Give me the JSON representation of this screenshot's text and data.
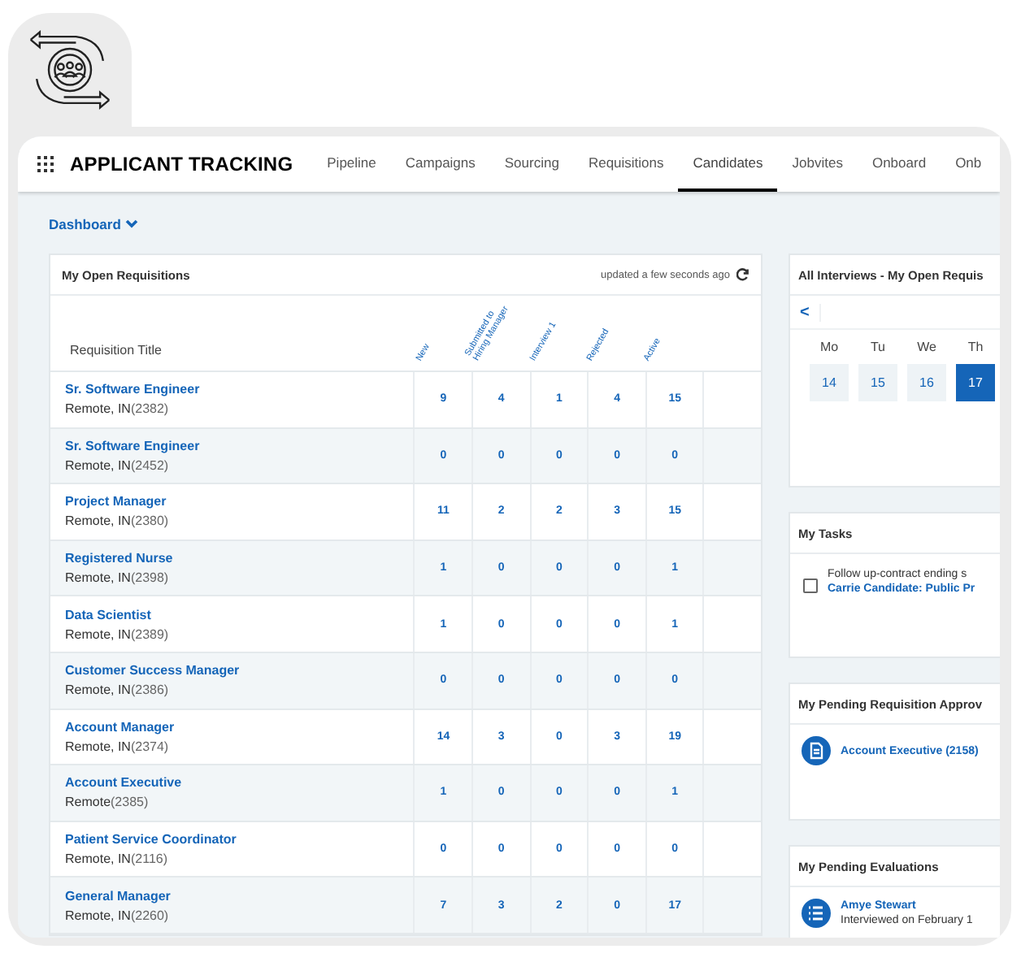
{
  "app": {
    "title": "APPLICANT TRACKING"
  },
  "tabs": [
    {
      "label": "Pipeline",
      "selected": false
    },
    {
      "label": "Campaigns",
      "selected": false
    },
    {
      "label": "Sourcing",
      "selected": false
    },
    {
      "label": "Requisitions",
      "selected": false
    },
    {
      "label": "Candidates",
      "selected": true
    },
    {
      "label": "Jobvites",
      "selected": false
    },
    {
      "label": "Onboard",
      "selected": false
    },
    {
      "label": "Onb",
      "selected": false
    }
  ],
  "breadcrumb": {
    "label": "Dashboard"
  },
  "requisitions": {
    "title": "My Open Requisitions",
    "updated": "updated a few seconds ago",
    "columns": [
      "Requisition Title",
      "New",
      "Submitted to Hiring Manager",
      "Interview 1",
      "Rejected",
      "Active"
    ],
    "rows": [
      {
        "title": "Sr. Software Engineer",
        "location": "Remote, IN",
        "id": "(2382)",
        "counts": [
          "9",
          "4",
          "1",
          "4",
          "15"
        ]
      },
      {
        "title": "Sr. Software Engineer",
        "location": "Remote, IN",
        "id": "(2452)",
        "counts": [
          "0",
          "0",
          "0",
          "0",
          "0"
        ]
      },
      {
        "title": "Project Manager",
        "location": "Remote, IN",
        "id": "(2380)",
        "counts": [
          "11",
          "2",
          "2",
          "3",
          "15"
        ]
      },
      {
        "title": "Registered Nurse",
        "location": "Remote, IN",
        "id": "(2398)",
        "counts": [
          "1",
          "0",
          "0",
          "0",
          "1"
        ]
      },
      {
        "title": "Data Scientist",
        "location": "Remote, IN",
        "id": "(2389)",
        "counts": [
          "1",
          "0",
          "0",
          "0",
          "1"
        ]
      },
      {
        "title": "Customer Success Manager",
        "location": "Remote, IN",
        "id": "(2386)",
        "counts": [
          "0",
          "0",
          "0",
          "0",
          "0"
        ]
      },
      {
        "title": "Account Manager",
        "location": "Remote, IN",
        "id": "(2374)",
        "counts": [
          "14",
          "3",
          "0",
          "3",
          "19"
        ]
      },
      {
        "title": "Account Executive",
        "location": "Remote",
        "id": "(2385)",
        "counts": [
          "1",
          "0",
          "0",
          "0",
          "1"
        ]
      },
      {
        "title": "Patient Service Coordinator",
        "location": "Remote, IN",
        "id": "(2116)",
        "counts": [
          "0",
          "0",
          "0",
          "0",
          "0"
        ]
      },
      {
        "title": "General Manager",
        "location": "Remote, IN",
        "id": "(2260)",
        "counts": [
          "7",
          "3",
          "2",
          "0",
          "17"
        ]
      }
    ]
  },
  "interviews": {
    "title": "All Interviews - My Open Requis",
    "prev": "<",
    "days": [
      {
        "weekday": "Mo",
        "date": "14",
        "selected": false
      },
      {
        "weekday": "Tu",
        "date": "15",
        "selected": false
      },
      {
        "weekday": "We",
        "date": "16",
        "selected": false
      },
      {
        "weekday": "Th",
        "date": "17",
        "selected": true
      }
    ]
  },
  "tasks": {
    "title": "My Tasks",
    "items": [
      {
        "text": "Follow up-contract ending s",
        "link": "Carrie Candidate: Public Pr",
        "checked": false
      }
    ]
  },
  "approvals": {
    "title": "My Pending Requisition Approv",
    "items": [
      {
        "label": "Account Executive (2158)"
      }
    ]
  },
  "evaluations": {
    "title": "My Pending Evaluations",
    "items": [
      {
        "name": "Amye Stewart",
        "detail": "Interviewed on February 1"
      }
    ]
  }
}
